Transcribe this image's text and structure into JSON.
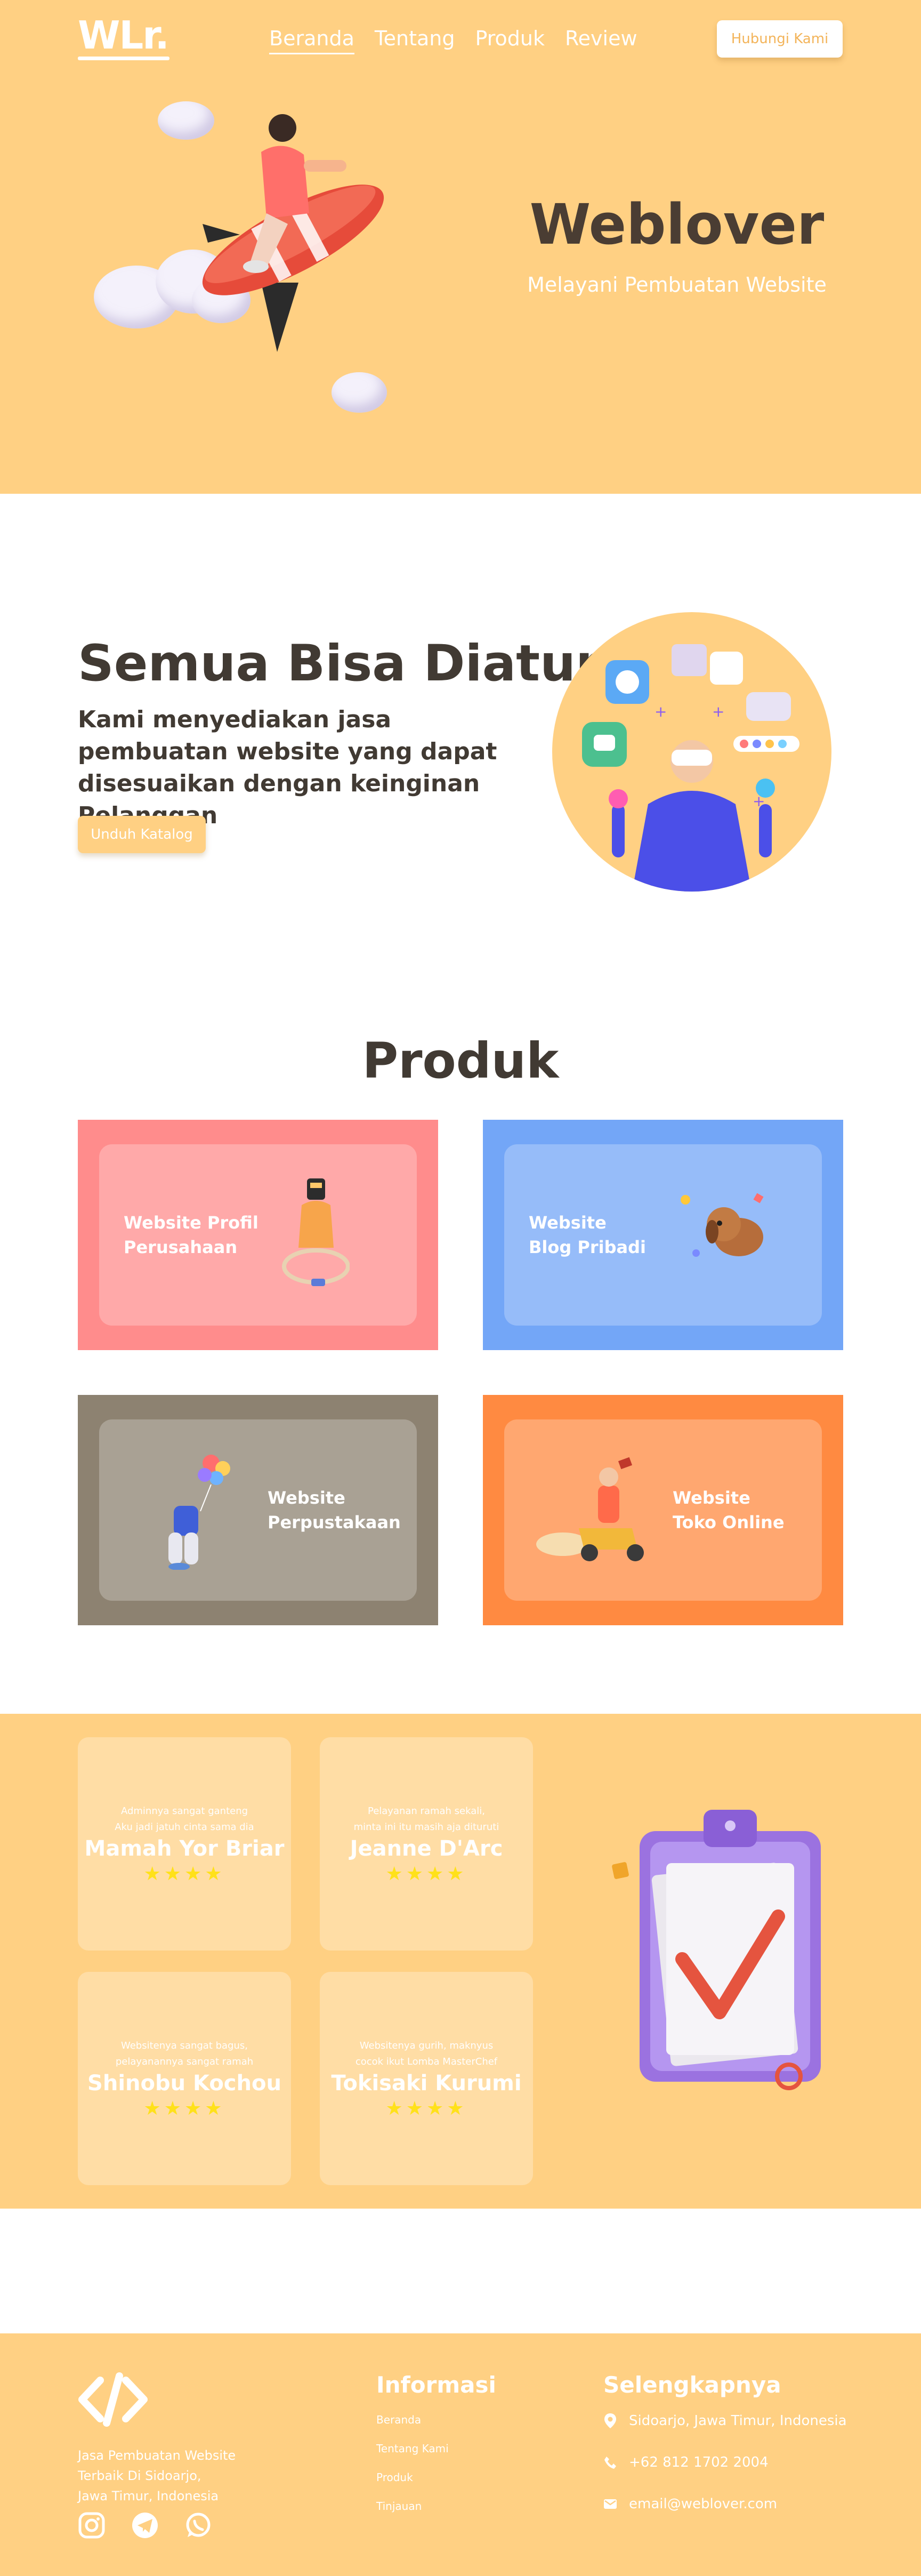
{
  "brand": {
    "logo": "WLr.",
    "accent_color": "#ffd083"
  },
  "nav": {
    "links": [
      "Beranda",
      "Tentang",
      "Produk",
      "Review"
    ],
    "contact_label": "Hubungi Kami"
  },
  "hero": {
    "title": "Weblover",
    "subtitle": "Melayani Pembuatan Website"
  },
  "about": {
    "title": "Semua Bisa Diatur",
    "description": "Kami menyediakan jasa pembuatan website yang dapat disesuaikan dengan keinginan Pelanggan",
    "button_label": "Unduh Katalog"
  },
  "products": {
    "title": "Produk",
    "items": [
      {
        "label": "Website Profil\nPerusahaan",
        "color": "#ff8c8c"
      },
      {
        "label": "Website\nBlog Pribadi",
        "color": "#73a6f7"
      },
      {
        "label": "Website\nPerpustakaan",
        "color": "#8d8271"
      },
      {
        "label": "Website\nToko Online",
        "color": "#ff8a41"
      }
    ]
  },
  "reviews": {
    "items": [
      {
        "comment": "Adminnya sangat ganteng\nAku jadi jatuh cinta sama dia",
        "name": "Mamah Yor Briar",
        "stars": "★★★★"
      },
      {
        "comment": "Pelayanan ramah sekali,\nminta ini itu masih aja dituruti",
        "name": "Jeanne D'Arc",
        "stars": "★★★★"
      },
      {
        "comment": "Websitenya sangat bagus,\npelayanannya sangat ramah",
        "name": "Shinobu Kochou",
        "stars": "★★★★"
      },
      {
        "comment": "Websitenya gurih, maknyus\ncocok ikut Lomba MasterChef",
        "name": "Tokisaki Kurumi",
        "stars": "★★★★"
      }
    ]
  },
  "footer": {
    "tagline": "Jasa Pembuatan Website\nTerbaik Di Sidoarjo,\nJawa Timur, Indonesia",
    "info_title": "Informasi",
    "info_links": [
      "Beranda",
      "Tentang Kami",
      "Produk",
      "Tinjauan"
    ],
    "more_title": "Selengkapnya",
    "address": "Sidoarjo, Jawa Timur, Indonesia",
    "phone": "+62 812 1702 2004",
    "email": "email@weblover.com",
    "social_icons": [
      "instagram-icon",
      "telegram-icon",
      "whatsapp-icon"
    ]
  }
}
